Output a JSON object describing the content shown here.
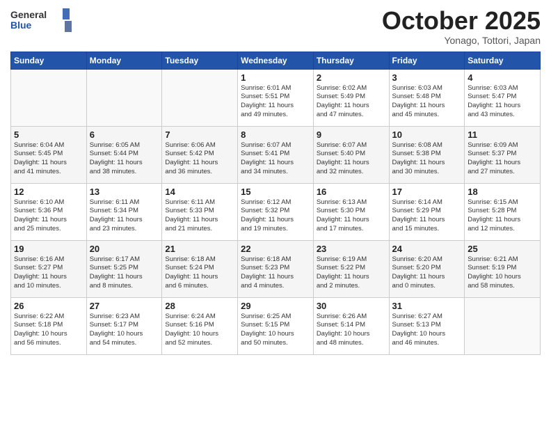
{
  "header": {
    "logo_general": "General",
    "logo_blue": "Blue",
    "month_title": "October 2025",
    "subtitle": "Yonago, Tottori, Japan"
  },
  "weekdays": [
    "Sunday",
    "Monday",
    "Tuesday",
    "Wednesday",
    "Thursday",
    "Friday",
    "Saturday"
  ],
  "weeks": [
    [
      {
        "day": "",
        "info": ""
      },
      {
        "day": "",
        "info": ""
      },
      {
        "day": "",
        "info": ""
      },
      {
        "day": "1",
        "info": "Sunrise: 6:01 AM\nSunset: 5:51 PM\nDaylight: 11 hours\nand 49 minutes."
      },
      {
        "day": "2",
        "info": "Sunrise: 6:02 AM\nSunset: 5:49 PM\nDaylight: 11 hours\nand 47 minutes."
      },
      {
        "day": "3",
        "info": "Sunrise: 6:03 AM\nSunset: 5:48 PM\nDaylight: 11 hours\nand 45 minutes."
      },
      {
        "day": "4",
        "info": "Sunrise: 6:03 AM\nSunset: 5:47 PM\nDaylight: 11 hours\nand 43 minutes."
      }
    ],
    [
      {
        "day": "5",
        "info": "Sunrise: 6:04 AM\nSunset: 5:45 PM\nDaylight: 11 hours\nand 41 minutes."
      },
      {
        "day": "6",
        "info": "Sunrise: 6:05 AM\nSunset: 5:44 PM\nDaylight: 11 hours\nand 38 minutes."
      },
      {
        "day": "7",
        "info": "Sunrise: 6:06 AM\nSunset: 5:42 PM\nDaylight: 11 hours\nand 36 minutes."
      },
      {
        "day": "8",
        "info": "Sunrise: 6:07 AM\nSunset: 5:41 PM\nDaylight: 11 hours\nand 34 minutes."
      },
      {
        "day": "9",
        "info": "Sunrise: 6:07 AM\nSunset: 5:40 PM\nDaylight: 11 hours\nand 32 minutes."
      },
      {
        "day": "10",
        "info": "Sunrise: 6:08 AM\nSunset: 5:38 PM\nDaylight: 11 hours\nand 30 minutes."
      },
      {
        "day": "11",
        "info": "Sunrise: 6:09 AM\nSunset: 5:37 PM\nDaylight: 11 hours\nand 27 minutes."
      }
    ],
    [
      {
        "day": "12",
        "info": "Sunrise: 6:10 AM\nSunset: 5:36 PM\nDaylight: 11 hours\nand 25 minutes."
      },
      {
        "day": "13",
        "info": "Sunrise: 6:11 AM\nSunset: 5:34 PM\nDaylight: 11 hours\nand 23 minutes."
      },
      {
        "day": "14",
        "info": "Sunrise: 6:11 AM\nSunset: 5:33 PM\nDaylight: 11 hours\nand 21 minutes."
      },
      {
        "day": "15",
        "info": "Sunrise: 6:12 AM\nSunset: 5:32 PM\nDaylight: 11 hours\nand 19 minutes."
      },
      {
        "day": "16",
        "info": "Sunrise: 6:13 AM\nSunset: 5:30 PM\nDaylight: 11 hours\nand 17 minutes."
      },
      {
        "day": "17",
        "info": "Sunrise: 6:14 AM\nSunset: 5:29 PM\nDaylight: 11 hours\nand 15 minutes."
      },
      {
        "day": "18",
        "info": "Sunrise: 6:15 AM\nSunset: 5:28 PM\nDaylight: 11 hours\nand 12 minutes."
      }
    ],
    [
      {
        "day": "19",
        "info": "Sunrise: 6:16 AM\nSunset: 5:27 PM\nDaylight: 11 hours\nand 10 minutes."
      },
      {
        "day": "20",
        "info": "Sunrise: 6:17 AM\nSunset: 5:25 PM\nDaylight: 11 hours\nand 8 minutes."
      },
      {
        "day": "21",
        "info": "Sunrise: 6:18 AM\nSunset: 5:24 PM\nDaylight: 11 hours\nand 6 minutes."
      },
      {
        "day": "22",
        "info": "Sunrise: 6:18 AM\nSunset: 5:23 PM\nDaylight: 11 hours\nand 4 minutes."
      },
      {
        "day": "23",
        "info": "Sunrise: 6:19 AM\nSunset: 5:22 PM\nDaylight: 11 hours\nand 2 minutes."
      },
      {
        "day": "24",
        "info": "Sunrise: 6:20 AM\nSunset: 5:20 PM\nDaylight: 11 hours\nand 0 minutes."
      },
      {
        "day": "25",
        "info": "Sunrise: 6:21 AM\nSunset: 5:19 PM\nDaylight: 10 hours\nand 58 minutes."
      }
    ],
    [
      {
        "day": "26",
        "info": "Sunrise: 6:22 AM\nSunset: 5:18 PM\nDaylight: 10 hours\nand 56 minutes."
      },
      {
        "day": "27",
        "info": "Sunrise: 6:23 AM\nSunset: 5:17 PM\nDaylight: 10 hours\nand 54 minutes."
      },
      {
        "day": "28",
        "info": "Sunrise: 6:24 AM\nSunset: 5:16 PM\nDaylight: 10 hours\nand 52 minutes."
      },
      {
        "day": "29",
        "info": "Sunrise: 6:25 AM\nSunset: 5:15 PM\nDaylight: 10 hours\nand 50 minutes."
      },
      {
        "day": "30",
        "info": "Sunrise: 6:26 AM\nSunset: 5:14 PM\nDaylight: 10 hours\nand 48 minutes."
      },
      {
        "day": "31",
        "info": "Sunrise: 6:27 AM\nSunset: 5:13 PM\nDaylight: 10 hours\nand 46 minutes."
      },
      {
        "day": "",
        "info": ""
      }
    ]
  ]
}
